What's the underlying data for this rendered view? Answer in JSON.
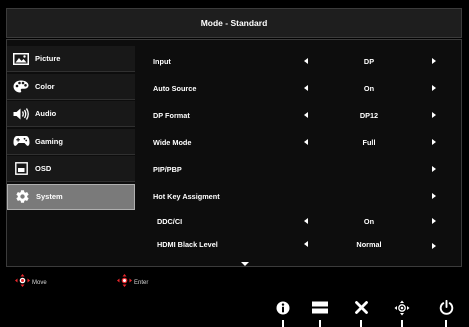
{
  "title": "Mode - Standard",
  "sidebar": {
    "items": [
      {
        "label": "Picture",
        "icon": "picture-icon"
      },
      {
        "label": "Color",
        "icon": "color-palette-icon"
      },
      {
        "label": "Audio",
        "icon": "speaker-icon"
      },
      {
        "label": "Gaming",
        "icon": "gamepad-icon"
      },
      {
        "label": "OSD",
        "icon": "osd-window-icon"
      },
      {
        "label": "System",
        "icon": "gear-icon",
        "active": true
      }
    ]
  },
  "settings": [
    {
      "label": "Input",
      "value": "DP"
    },
    {
      "label": "Auto Source",
      "value": "On"
    },
    {
      "label": "DP Format",
      "value": "DP12"
    },
    {
      "label": "Wide Mode",
      "value": "Full"
    },
    {
      "label": "PIP/PBP",
      "value": ""
    },
    {
      "label": "Hot Key Assigment",
      "value": ""
    },
    {
      "label": "DDC/CI",
      "value": "On"
    },
    {
      "label": "HDMI Black Level",
      "value": "Normal"
    }
  ],
  "hints": {
    "move": "Move",
    "enter": "Enter"
  },
  "buttons": [
    {
      "name": "info-button",
      "icon": "info-icon"
    },
    {
      "name": "menu-button",
      "icon": "menu-icon"
    },
    {
      "name": "close-button",
      "icon": "close-icon"
    },
    {
      "name": "navigate-button",
      "icon": "dpad-icon"
    },
    {
      "name": "power-button",
      "icon": "power-icon"
    }
  ],
  "colors": {
    "accent": "#e8262b",
    "active_item": "#7a7a7a",
    "background": "#000000"
  }
}
